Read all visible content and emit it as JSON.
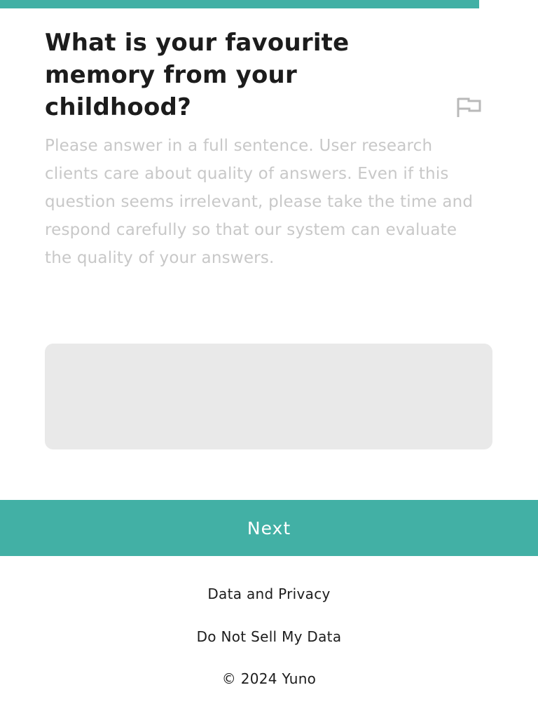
{
  "progress": {
    "fraction": 0.89,
    "color": "#42b0a5"
  },
  "question": {
    "title": "What is your favourite memory from your childhood?",
    "helper": "Please answer in a full sentence. User research clients care about quality of answers. Even if this question seems irrelevant, please take the time and respond carefully so that our system can evaluate the quality of your answers.",
    "flag_icon": "flag-icon"
  },
  "answer": {
    "value": "",
    "placeholder": ""
  },
  "actions": {
    "next_label": "Next"
  },
  "footer": {
    "privacy_label": "Data and Privacy",
    "do_not_sell_label": "Do Not Sell My Data",
    "copyright": "© 2024 Yuno"
  }
}
